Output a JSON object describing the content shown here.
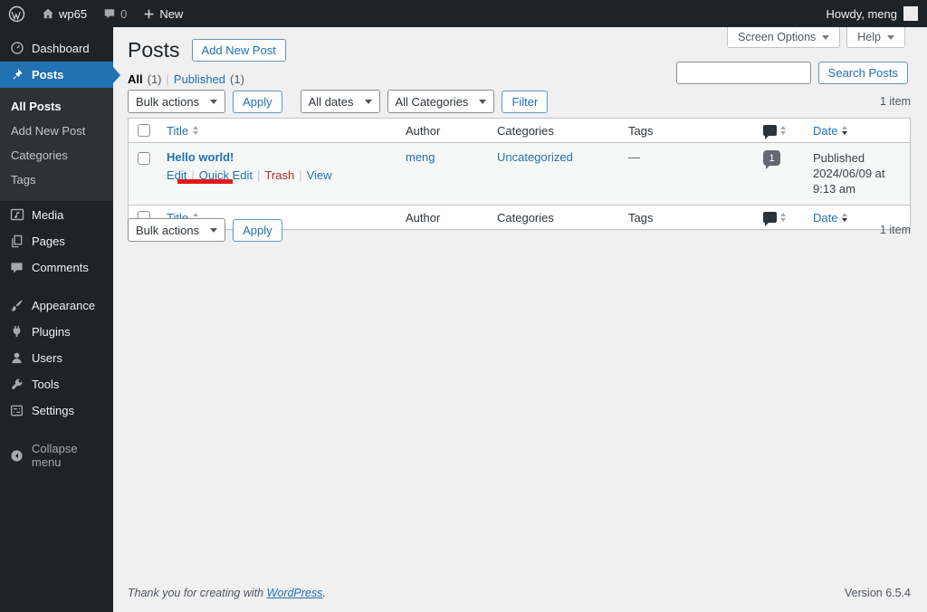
{
  "admin_bar": {
    "site_name": "wp65",
    "comment_count": "0",
    "new_label": "New",
    "howdy": "Howdy, meng"
  },
  "sidebar": {
    "dashboard": "Dashboard",
    "posts": "Posts",
    "posts_submenu": [
      "All Posts",
      "Add New Post",
      "Categories",
      "Tags"
    ],
    "media": "Media",
    "pages": "Pages",
    "comments": "Comments",
    "appearance": "Appearance",
    "plugins": "Plugins",
    "users": "Users",
    "tools": "Tools",
    "settings": "Settings",
    "collapse": "Collapse menu"
  },
  "header": {
    "title": "Posts",
    "add_new_button": "Add New Post",
    "screen_options": "Screen Options",
    "help": "Help"
  },
  "views": {
    "all": "All",
    "all_count": "(1)",
    "separator": "|",
    "published": "Published",
    "published_count": "(1)"
  },
  "search": {
    "button": "Search Posts"
  },
  "tablenav": {
    "bulk_actions": "Bulk actions",
    "apply": "Apply",
    "all_dates": "All dates",
    "all_categories": "All Categories",
    "filter": "Filter",
    "item_count": "1 item"
  },
  "table": {
    "headers": {
      "title": "Title",
      "author": "Author",
      "categories": "Categories",
      "tags": "Tags",
      "date": "Date"
    },
    "row": {
      "title": "Hello world!",
      "author": "meng",
      "category": "Uncategorized",
      "tags_value": "—",
      "comment_count": "1",
      "status": "Published",
      "date": "2024/06/09 at 9:13 am",
      "actions": {
        "edit": "Edit",
        "quick_edit": "Quick Edit",
        "trash": "Trash",
        "view": "View",
        "separator": "|"
      }
    }
  },
  "footer": {
    "thanks": "Thank you for creating with",
    "wordpress": "WordPress",
    "period": ".",
    "version": "Version 6.5.4"
  },
  "colors": {
    "accent": "#2271b1",
    "admin_dark": "#1d2327",
    "submenu_bg": "#2c3338",
    "annotation_red": "#e21b1b",
    "trash_red": "#b32d2e"
  }
}
